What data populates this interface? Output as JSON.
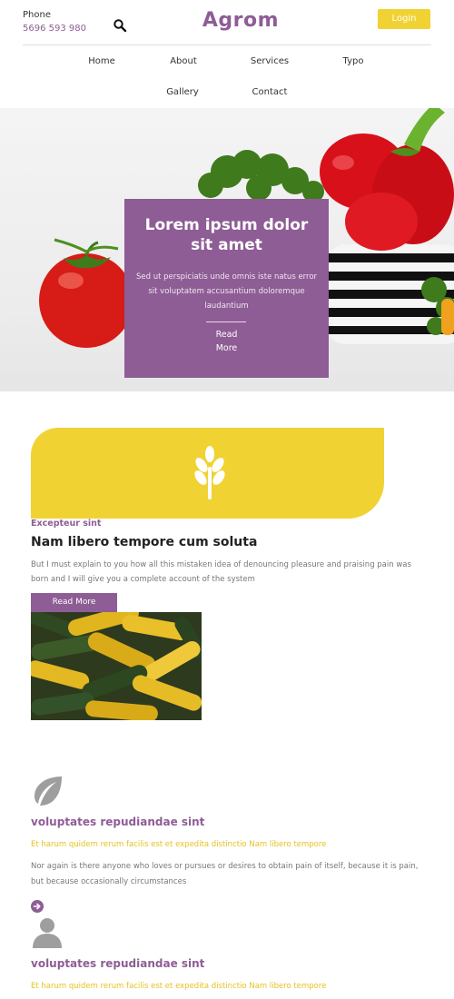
{
  "header": {
    "phone_label": "Phone",
    "phone_number": "5696 593 980",
    "logo": "Agrom",
    "login_label": "Login",
    "search_icon": "search-icon"
  },
  "nav": {
    "items": [
      "Home",
      "About",
      "Services",
      "Typo",
      "Gallery",
      "Contact"
    ]
  },
  "hero": {
    "title": "Lorem ipsum dolor sit amet",
    "text": "Sed ut perspiciatis unde omnis iste natus error sit voluptatem accusantium doloremque laudantium",
    "read_more": "Read More"
  },
  "intro": {
    "icon": "wheat-icon",
    "kicker": "Excepteur sint",
    "title": "Nam libero tempore cum soluta",
    "text": "But I must explain to you how all this mistaken idea of denouncing pleasure and praising pain was born and I will give you a complete account of the system",
    "button": "Read More"
  },
  "features": [
    {
      "icon": "leaf-icon",
      "title": "voluptates repudiandae sint",
      "subtitle": "Et harum quidem rerum facilis est et expedita distinctio Nam libero tempore",
      "text": "Nor again is there anyone who loves or pursues or desires to obtain pain of itself, because it is pain, but because occasionally circumstances"
    },
    {
      "icon": "user-icon",
      "title": "voluptates repudiandae sint",
      "subtitle": "Et harum quidem rerum facilis est et expedita distinctio Nam libero tempore"
    }
  ],
  "colors": {
    "brand_purple": "#8e5d95",
    "accent_yellow": "#f0d233"
  }
}
